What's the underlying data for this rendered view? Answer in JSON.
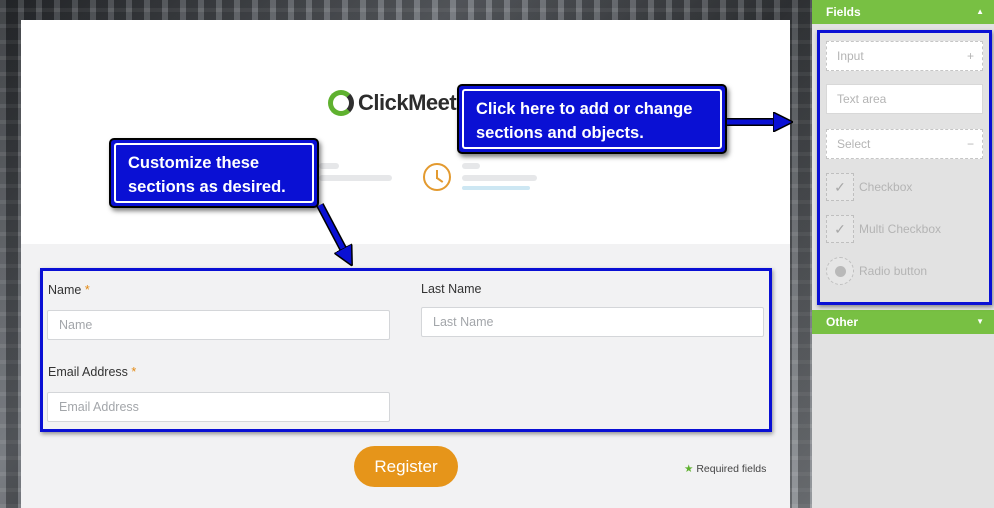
{
  "brand": {
    "logo_text": "ClickMeeti"
  },
  "form": {
    "name_label": "Name",
    "name_required_mark": "*",
    "name_placeholder": "Name",
    "last_name_label": "Last Name",
    "last_name_placeholder": "Last Name",
    "email_label": "Email Address",
    "email_required_mark": "*",
    "email_placeholder": "Email Address",
    "register_label": "Register",
    "required_star": "★",
    "required_note": "Required fields"
  },
  "callouts": {
    "customize": "Customize these sections as desired.",
    "add_change": "Click here to add or change sections and objects."
  },
  "panel": {
    "fields_title": "Fields",
    "fields_toggle": "▲",
    "other_title": "Other",
    "other_toggle": "▼",
    "input": "Input",
    "input_sign": "+",
    "textarea": "Text area",
    "select": "Select",
    "select_sign": "−",
    "checkbox": "Checkbox",
    "multi_checkbox": "Multi Checkbox",
    "radio": "Radio button",
    "check_glyph": "✓"
  },
  "colors": {
    "accent_green": "#78c043",
    "register_orange": "#e6951a",
    "annotation_blue": "#0a10d4"
  },
  "icons": [
    "clickmeeting-logo-icon",
    "clock-icon",
    "check-icon",
    "radio-icon",
    "arrow-icon"
  ]
}
